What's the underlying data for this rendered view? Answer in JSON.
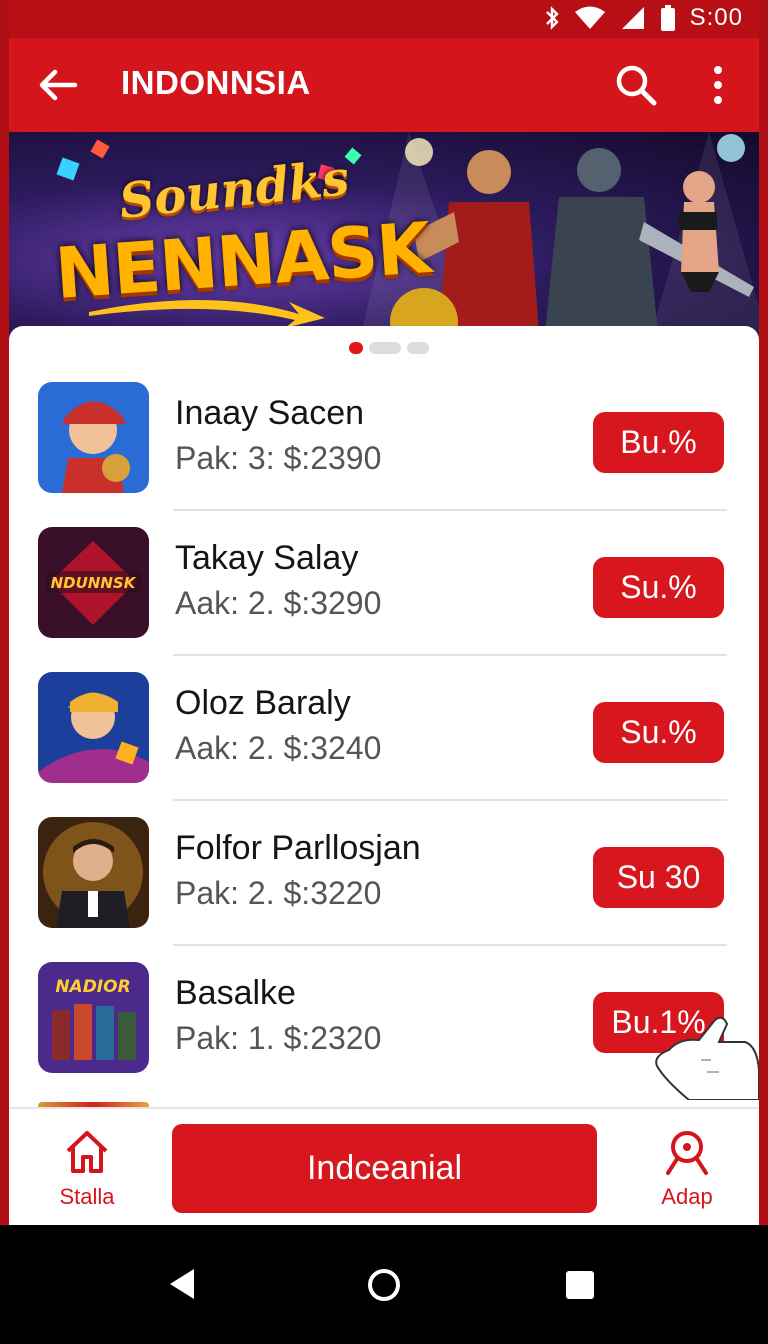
{
  "status_bar": {
    "time": "S:00"
  },
  "app_bar": {
    "title": "INDONNSIA"
  },
  "banner": {
    "line1": "Soundks",
    "line2": "NENNASK"
  },
  "carousel": {
    "page_count": 3,
    "active_index": 0
  },
  "items": [
    {
      "name": "Inaay Sacen",
      "meta": "Pak: 3:  $:2390",
      "button": "Bu.%",
      "thumb_colors": [
        "#2a6bd6",
        "#c9302c"
      ]
    },
    {
      "name": "Takay Salay",
      "meta": "Aak: 2.  $:3290",
      "button": "Su.%",
      "thumb_colors": [
        "#3a0f2a",
        "#e0a020"
      ],
      "thumb_text": "NDUNNSK"
    },
    {
      "name": "Oloz Baraly",
      "meta": "Aak: 2.  $:3240",
      "button": "Su.%",
      "thumb_colors": [
        "#1b3f9a",
        "#f0b030"
      ]
    },
    {
      "name": "Folfor Parllosjan",
      "meta": "Pak: 2.  $:3220",
      "button": "Su 30",
      "thumb_colors": [
        "#3a2410",
        "#ffb030"
      ]
    },
    {
      "name": "Basalke",
      "meta": "Pak: 1.  $:2320",
      "button": "Bu.1%",
      "thumb_colors": [
        "#4b2a8c",
        "#ffcc33"
      ],
      "thumb_text": "NADIOR"
    }
  ],
  "bottom_bar": {
    "left_label": "Stalla",
    "cta_label": "Indceanial",
    "right_label": "Adap"
  },
  "colors": {
    "primary": "#d4161c",
    "status_bar": "#b80f17"
  }
}
